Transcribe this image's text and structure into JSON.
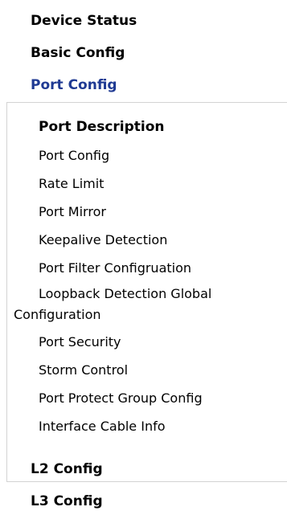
{
  "nav": {
    "device_status": "Device Status",
    "basic_config": "Basic Config",
    "port_config": "Port Config",
    "l2_config": "L2 Config",
    "l3_config": "L3 Config"
  },
  "port_config_menu": {
    "items": [
      "Port Description",
      "Port Config",
      "Rate Limit",
      "Port Mirror",
      "Keepalive Detection",
      "Port Filter Configruation",
      "Loopback Detection Global",
      "Configuration",
      "Port Security",
      "Storm Control",
      "Port Protect Group Config",
      "Interface Cable Info"
    ]
  },
  "colors": {
    "active": "#1f3a93",
    "border": "#d3d3d3"
  }
}
